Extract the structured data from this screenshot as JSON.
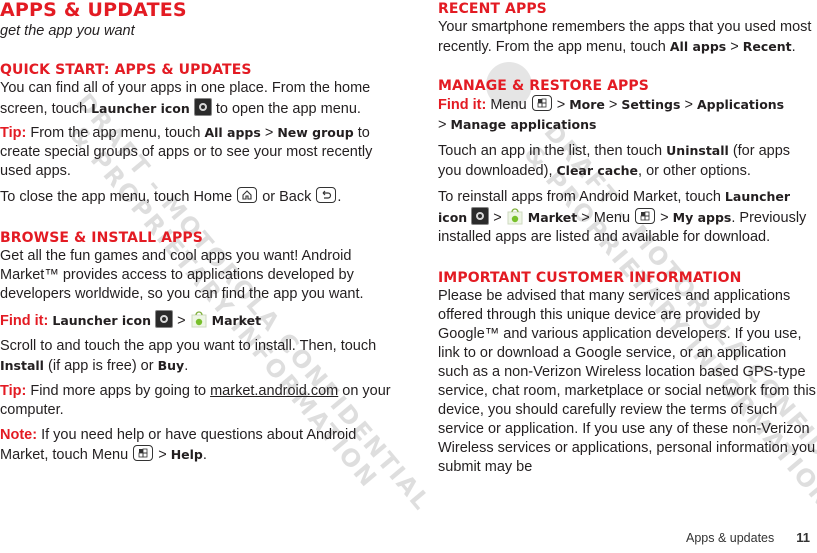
{
  "left": {
    "title": "APPS & UPDATES",
    "subtitle": "get the app you want",
    "quick_start": {
      "heading": "QUICK START: APPS & UPDATES",
      "p1_pre": "You can find all of your apps in one place. From the home screen, touch ",
      "p1_bold": "Launcher icon",
      "p1_post": " to open the app menu.",
      "tip_label": "Tip:",
      "tip_pre": " From the app menu, touch ",
      "tip_b1": "All apps",
      "tip_sep": " > ",
      "tip_b2": "New group",
      "tip_post": " to create special groups of apps or to see your most recently used apps.",
      "close_pre": "To close the app menu, touch Home ",
      "close_mid": " or Back ",
      "close_post": "."
    },
    "browse": {
      "heading": "BROWSE & INSTALL APPS",
      "p1": "Get all the fun games and cool apps you want! Android Market™ provides access to applications developed by developers worldwide, so you can find the app you want.",
      "findit_label": "Find it:",
      "findit_b1": "Launcher icon",
      "findit_sep": " > ",
      "findit_b2": "Market",
      "p2_pre": "Scroll to and touch the app you want to install. Then, touch ",
      "p2_b1": "Install",
      "p2_mid": " (if app is free) or ",
      "p2_b2": "Buy",
      "p2_post": ".",
      "tip_label": "Tip:",
      "tip_pre": " Find more apps by going to ",
      "tip_link": "market.android.com",
      "tip_post": " on your computer.",
      "note_label": "Note:",
      "note_pre": " If you need help or have questions about Android Market, touch Menu ",
      "note_sep": " > ",
      "note_b": "Help",
      "note_post": "."
    }
  },
  "right": {
    "recent": {
      "heading": "RECENT APPS",
      "p_pre": "Your smartphone remembers the apps that you used most recently. From the app menu, touch ",
      "p_b1": "All apps",
      "p_sep": " > ",
      "p_b2": "Recent",
      "p_post": "."
    },
    "manage": {
      "heading": "MANAGE & RESTORE APPS",
      "findit_label": "Find it:",
      "findit_pre": " Menu ",
      "findit_sep": " > ",
      "findit_b1": "More",
      "findit_b2": "Settings",
      "findit_b3": "Applications",
      "findit_b4": "Manage applications",
      "p1_pre": "Touch an app in the list, then touch ",
      "p1_b1": "Uninstall",
      "p1_mid": " (for apps you downloaded), ",
      "p1_b2": "Clear cache",
      "p1_post": ", or other options.",
      "p2_pre": "To reinstall apps from Android Market, touch ",
      "p2_b1": "Launcher icon",
      "p2_sep": " > ",
      "p2_b2": "Market",
      "p2_menu": " > Menu ",
      "p2_b3": "My apps",
      "p2_post": ". Previously installed apps are listed and available for download."
    },
    "important": {
      "heading": "IMPORTANT CUSTOMER INFORMATION",
      "p": "Please be advised that many services and applications offered through this unique device are provided by Google™ and various application developers. If you use, link to or download a Google service, or an application such as a non-Verizon Wireless location based GPS-type service, chat room, marketplace or social network from this device, you should carefully review the terms of such service or application. If you use any of these non-Verizon Wireless services or applications, personal information you submit may be"
    }
  },
  "footer": {
    "section": "Apps & updates",
    "page_number": "11"
  },
  "watermarks": {
    "left_line1": "DRAFT - MOTOROLA CONFIDENTIAL",
    "left_line2": "& PROPRIETARY INFORMATION",
    "right_line1": "DRAFT - MOTOROLA CONFIDENTIAL",
    "right_line2": "& PROPRIETARY INFORMATION"
  },
  "colors": {
    "accent": "#e31b23",
    "text": "#231f20"
  }
}
